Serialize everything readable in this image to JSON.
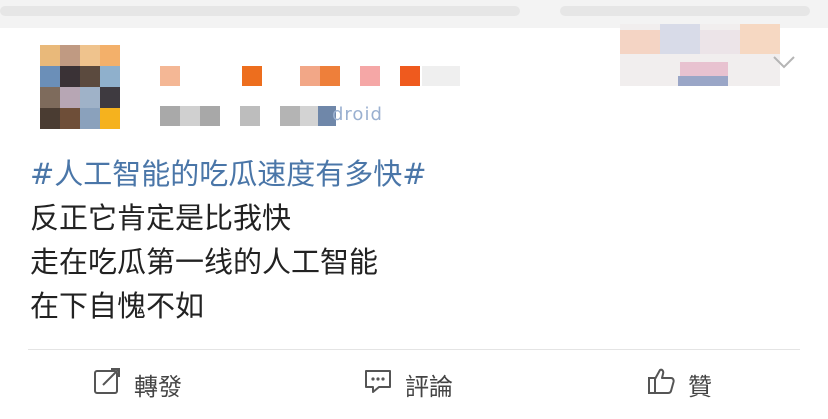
{
  "post": {
    "hashtag": "#人工智能的吃瓜速度有多快#",
    "lines": [
      "反正它肯定是比我快",
      "走在吃瓜第一线的人工智能",
      "在下自愧不如"
    ],
    "source_fragment": "droid"
  },
  "actions": {
    "repost_label": "轉發",
    "comment_label": "評論",
    "like_label": "贊"
  },
  "icons": {
    "repost": "share-edit-icon",
    "comment": "comment-bubble-icon",
    "like": "thumbs-up-icon",
    "menu": "chevron-down-icon"
  },
  "colors": {
    "hashtag": "#4a76a8",
    "text": "#222222",
    "action_text": "#444444"
  }
}
